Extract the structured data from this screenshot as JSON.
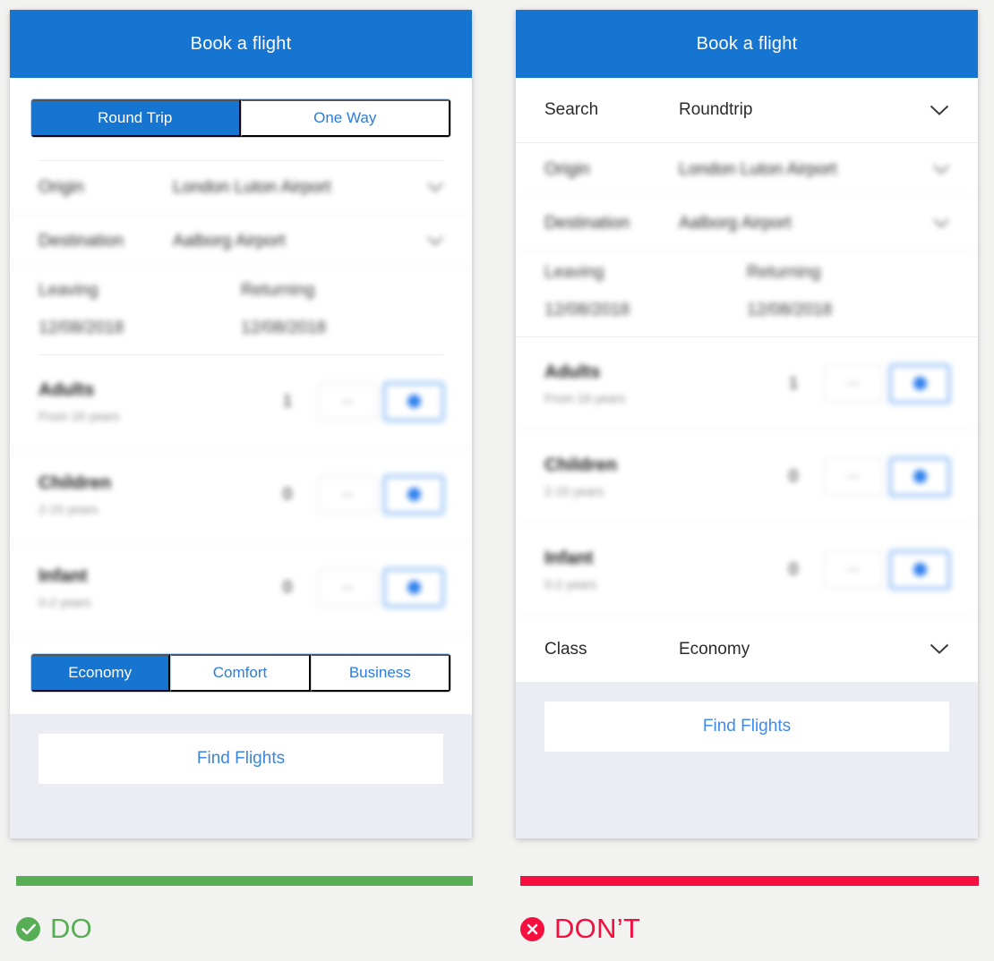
{
  "page": {
    "background": "#f2f2f1",
    "accent_blue": "#1675d1",
    "do_color": "#58ae54",
    "dont_color": "#f40f3f"
  },
  "do_panel": {
    "title": "Book a flight",
    "trip_type_segments": [
      {
        "label": "Round Trip",
        "active": true
      },
      {
        "label": "One Way",
        "active": false
      }
    ],
    "rows": [
      {
        "label": "Origin",
        "value": "London Luton Airport",
        "icon": "chevron-down-icon"
      },
      {
        "label": "Destination",
        "value": "Aalborg Airport",
        "icon": "chevron-down-icon"
      }
    ],
    "dates": {
      "leaving_label": "Leaving",
      "leaving_value": "12/08/2018",
      "returning_label": "Returning",
      "returning_value": "12/08/2018"
    },
    "passengers": [
      {
        "title": "Adults",
        "subtitle": "From 16 years",
        "count": "1"
      },
      {
        "title": "Children",
        "subtitle": "2-15 years",
        "count": "0"
      },
      {
        "title": "Infant",
        "subtitle": "0-2 years",
        "count": "0"
      }
    ],
    "class_segments": [
      {
        "label": "Economy",
        "active": true
      },
      {
        "label": "Comfort",
        "active": false
      },
      {
        "label": "Business",
        "active": false
      }
    ],
    "submit_label": "Find Flights"
  },
  "dont_panel": {
    "title": "Book a flight",
    "search_row": {
      "label": "Search",
      "value": "Roundtrip",
      "icon": "chevron-down-icon"
    },
    "rows": [
      {
        "label": "Origin",
        "value": "London Luton Airport",
        "icon": "chevron-down-icon"
      },
      {
        "label": "Destination",
        "value": "Aalborg Airport",
        "icon": "chevron-down-icon"
      }
    ],
    "dates": {
      "leaving_label": "Leaving",
      "leaving_value": "12/08/2018",
      "returning_label": "Returning",
      "returning_value": "12/08/2018"
    },
    "passengers": [
      {
        "title": "Adults",
        "subtitle": "From 16 years",
        "count": "1"
      },
      {
        "title": "Children",
        "subtitle": "2-15 years",
        "count": "0"
      },
      {
        "title": "Infant",
        "subtitle": "0-2 years",
        "count": "0"
      }
    ],
    "class_row": {
      "label": "Class",
      "value": "Economy",
      "icon": "chevron-down-icon"
    },
    "submit_label": "Find Flights"
  },
  "captions": {
    "do": {
      "text": "DO",
      "icon": "check-circle-icon"
    },
    "dont": {
      "text": "DON’T",
      "icon": "x-circle-icon"
    }
  },
  "stepper": {
    "decrement_icon": "minus-icon",
    "increment_icon": "plus-icon"
  }
}
